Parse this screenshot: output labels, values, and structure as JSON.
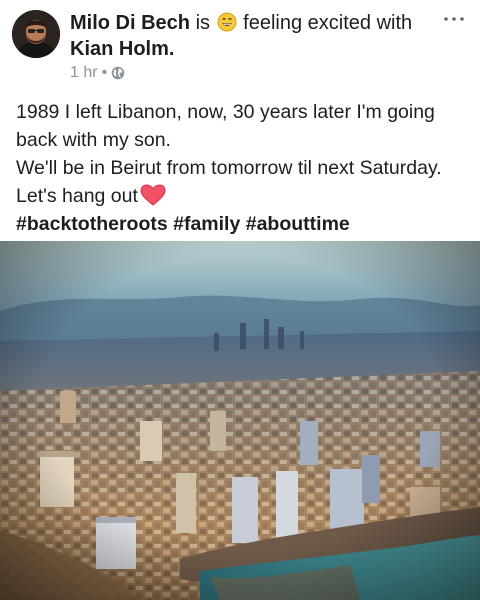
{
  "post": {
    "author": "Milo Di Bech",
    "is_text": "is",
    "feeling_text": "feeling excited with",
    "tagged": "Kian Holm.",
    "time": "1 hr",
    "separator": "•",
    "privacy_icon": "globe-icon",
    "more_icon": "more-options-icon",
    "feeling_icon": "grinning-face-emoji",
    "lines": [
      "1989 I left Libanon, now, 30 years later I'm going",
      "back with my son.",
      "We'll be in Beirut from tomorrow til next Saturday.",
      "Let's hang out"
    ],
    "heart_icon": "red-heart-emoji",
    "hashtags": "#backtotheroots #family #abouttime",
    "photo_subject": "aerial city photo"
  },
  "colors": {
    "text": "#1c1e21",
    "meta": "#8d949e",
    "heart": "#f25268"
  }
}
